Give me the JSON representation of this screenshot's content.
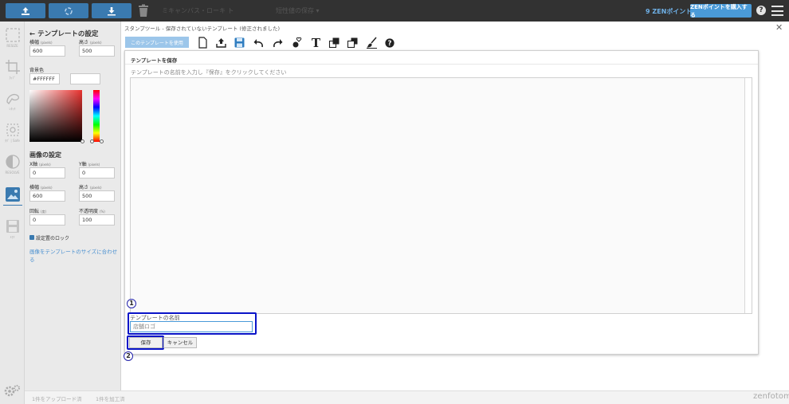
{
  "topbar": {
    "dim_text_1": "ミキャンバス・ローキ ト",
    "dim_text_2": "短性値の保存 ▾",
    "points": "9 ZENポイント",
    "buy_button": "ZENポイントを購入する",
    "help": "?"
  },
  "strip": {
    "items": [
      {
        "icon": "resize-icon",
        "label": "RESIZE"
      },
      {
        "icon": "crop-icon",
        "label": "ｶｯﾌﾟ"
      },
      {
        "icon": "retouch-icon",
        "label": "ﾚﾀｯﾁ"
      },
      {
        "icon": "stamp-icon",
        "label": "ﾀｸﾞ | Safe"
      },
      {
        "icon": "contrast-icon",
        "label": "RESOLVE"
      },
      {
        "icon": "image-icon",
        "label": ""
      },
      {
        "icon": "save-icon",
        "label": "ﾒﾓﾘ"
      }
    ]
  },
  "panel": {
    "title": "テンプレートの設定",
    "width_label": "横幅",
    "height_label": "高さ",
    "unit_pixels": "(pixels)",
    "width_value": "600",
    "height_value": "500",
    "bg_label": "背景色",
    "bg_value": "#FFFFFF",
    "image_section": "画像の設定",
    "x_label": "X軸",
    "y_label": "Y軸",
    "x_value": "0",
    "y_value": "0",
    "img_width_value": "600",
    "img_height_value": "500",
    "rotate_label": "回転",
    "rotate_unit": "(度)",
    "opacity_label": "不透明度",
    "opacity_unit": "(%)",
    "rotate_value": "0",
    "opacity_value": "100",
    "lock_label": "設定置のロック",
    "fit_link": "画像をテンプレートのサイズに合わせる"
  },
  "status": {
    "uploaded": "1件をアップロード済",
    "processed": "1件を加工済",
    "brand": "zenfotomatic"
  },
  "editor": {
    "breadcrumb": "スタンプツール - 保存されていないテンプレート (修正されました)",
    "use_button": "このテンプレートを使用",
    "tools": [
      "new-file-icon",
      "upload-icon",
      "floppy-save-icon",
      "undo-icon",
      "redo-icon",
      "heart-stamp-icon",
      "text-icon",
      "bring-front-icon",
      "send-back-icon",
      "brush-icon",
      "help-icon"
    ]
  },
  "dialog": {
    "title": "テンプレートを保存",
    "instruction": "テンプレートの名前を入力し『保存』をクリックしてください",
    "name_label": "テンプレートの名前",
    "name_value": "店舗ロゴ",
    "save": "保存",
    "cancel": "キャンセル",
    "marker_1": "1",
    "marker_2": "2"
  },
  "colors": {
    "topbar": "#323232",
    "accent": "#3a7ab0",
    "highlight": "#0a14c8",
    "link": "#4a90d0"
  }
}
